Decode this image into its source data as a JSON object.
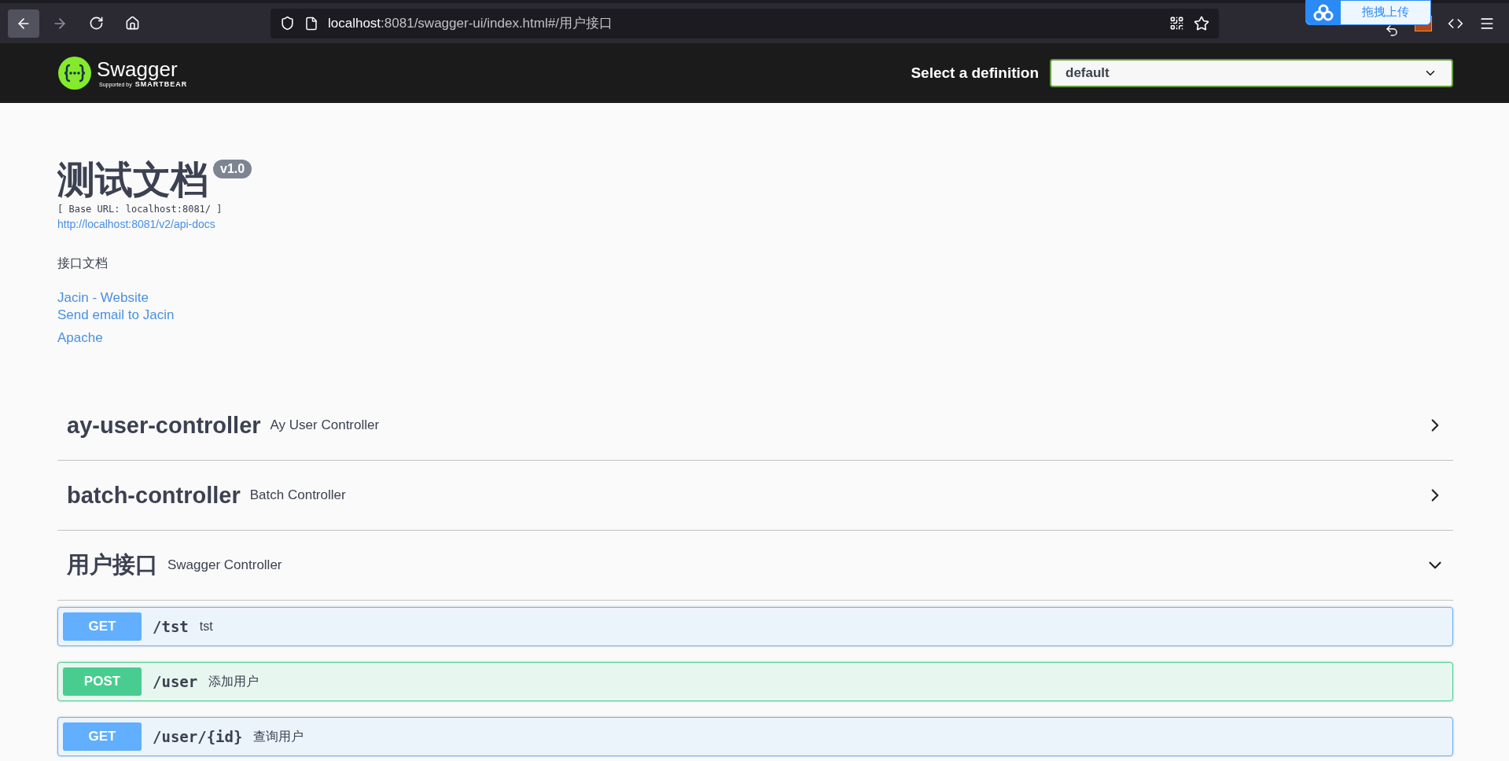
{
  "browser": {
    "url_host": "localhost",
    "url_rest": ":8081/swagger-ui/index.html#/用户接口",
    "popup_label": "拖拽上传"
  },
  "header": {
    "brand": "Swagger",
    "tagline_prefix": "Supported by",
    "tagline_brand": "SMARTBEAR",
    "definition_label": "Select a definition",
    "definition_value": "default"
  },
  "info": {
    "title": "测试文档",
    "version": "v1.0",
    "base_url": "[ Base URL: localhost:8081/ ]",
    "spec_link": "http://localhost:8081/v2/api-docs",
    "description": "接口文档",
    "links": [
      "Jacin - Website",
      "Send email to Jacin",
      "Apache"
    ]
  },
  "tags": [
    {
      "name": "ay-user-controller",
      "description": "Ay User Controller",
      "expanded": false
    },
    {
      "name": "batch-controller",
      "description": "Batch Controller",
      "expanded": false
    },
    {
      "name": "用户接口",
      "description": "Swagger Controller",
      "expanded": true,
      "operations": [
        {
          "method": "GET",
          "path": "/tst",
          "summary": "tst"
        },
        {
          "method": "POST",
          "path": "/user",
          "summary": "添加用户"
        },
        {
          "method": "GET",
          "path": "/user/{id}",
          "summary": "查询用户"
        }
      ]
    }
  ]
}
